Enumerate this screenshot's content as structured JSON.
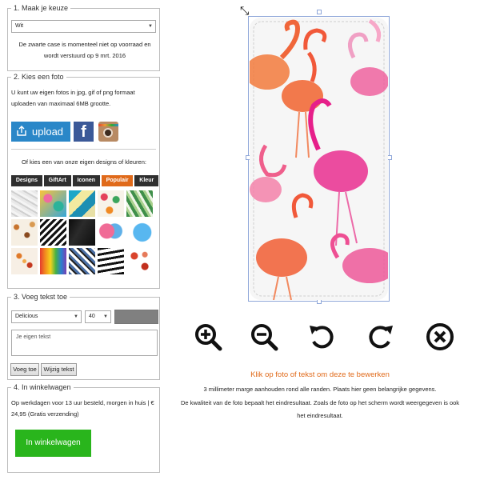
{
  "sections": {
    "s1": {
      "title": "1. Maak je keuze",
      "select_value": "Wit",
      "notice": "De zwarte case is momenteel niet op voorraad en wordt verstuurd op 9 mrt. 2016"
    },
    "s2": {
      "title": "2. Kies een foto",
      "intro": "U kunt uw eigen fotos in jpg, gif of png formaat uploaden van maximaal 6MB grootte.",
      "upload_label": "upload",
      "facebook_label": "f",
      "designs_intro": "Of kies een van onze eigen designs of kleuren:",
      "tabs": [
        "Designs",
        "GiftArt",
        "Iconen",
        "Populair",
        "Kleur"
      ],
      "active_tab": "Populair",
      "thumbnails": [
        "marble",
        "tropical",
        "geometric",
        "dots",
        "leaves",
        "feathers",
        "chevron",
        "black-marble",
        "heart",
        "blue-heart",
        "animals",
        "rainbow",
        "zigzag",
        "stripes",
        "lips"
      ]
    },
    "s3": {
      "title": "3. Voeg tekst toe",
      "font_value": "Delicious",
      "size_value": "40",
      "color_value": "#808080",
      "text_placeholder": "Je eigen tekst",
      "add_button": "Voeg toe",
      "edit_button": "Wijzig tekst"
    },
    "s4": {
      "title": "4. In winkelwagen",
      "delivery": "Op werkdagen voor 13 uur besteld, morgen in huis | € 24,95 (Gratis verzending)",
      "cart_button": "In winkelwagen"
    }
  },
  "editor": {
    "tools": [
      "zoom-in-icon",
      "zoom-out-icon",
      "rotate-left-icon",
      "rotate-right-icon",
      "close-icon"
    ],
    "hint": "Klik op foto of tekst om deze te bewerken",
    "line1": "3 millimeter marge aanhouden rond alle randen. Plaats hier geen belangrijke gegevens.",
    "line2": "De kwaliteit van de foto bepaalt het eindresultaat. Zoals de foto op het scherm wordt weergegeven is ook",
    "line3": "het eindresultaat."
  },
  "colors": {
    "accent_orange": "#e06a1a",
    "cart_green": "#29b51c",
    "upload_blue": "#2a87c8",
    "facebook_blue": "#3b5998"
  }
}
